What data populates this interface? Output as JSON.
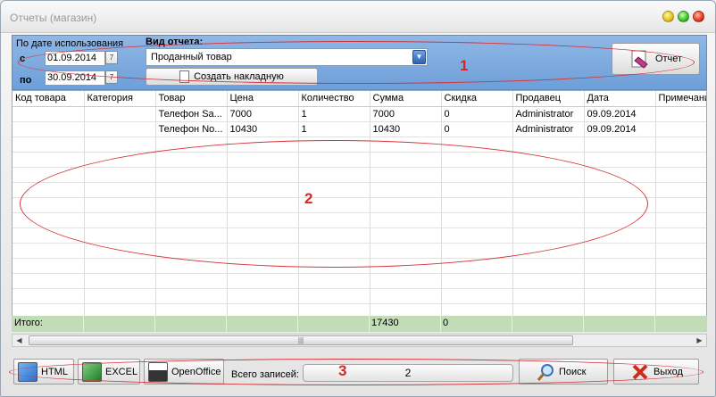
{
  "window": {
    "title": "Отчеты (магазин)"
  },
  "filters": {
    "by_date_label": "По дате использования",
    "from_label": "с",
    "to_label": "по",
    "from_date": "01.09.2014",
    "to_date": "30.09.2014",
    "calendar_glyph": "7",
    "report_type_label": "Вид отчета:",
    "report_type_value": "Проданный товар",
    "create_invoice_label": "Создать накладную",
    "report_button_label": "Отчет"
  },
  "table": {
    "columns": [
      "Код товара",
      "Категория",
      "Товар",
      "Цена",
      "Количество",
      "Сумма",
      "Скидка",
      "Продавец",
      "Дата",
      "Примечание"
    ],
    "rows": [
      [
        "",
        "",
        "Телефон Sa...",
        "7000",
        "1",
        "7000",
        "0",
        "Administrator",
        "09.09.2014",
        ""
      ],
      [
        "",
        "",
        "Телефон No...",
        "10430",
        "1",
        "10430",
        "0",
        "Administrator",
        "09.09.2014",
        ""
      ]
    ],
    "total_label": "Итого:",
    "total_sum": "17430",
    "total_discount": "0"
  },
  "bottom": {
    "html_label": "HTML",
    "excel_label": "EXCEL",
    "openoffice_label": "OpenOffice",
    "records_label": "Всего записей:",
    "records_count": "2",
    "search_label": "Поиск",
    "exit_label": "Выход"
  },
  "annotations": [
    "1",
    "2",
    "3"
  ],
  "colors": {
    "panel": "#7ba9df",
    "total_row": "#c3dcb8",
    "annotation": "#e02222"
  }
}
